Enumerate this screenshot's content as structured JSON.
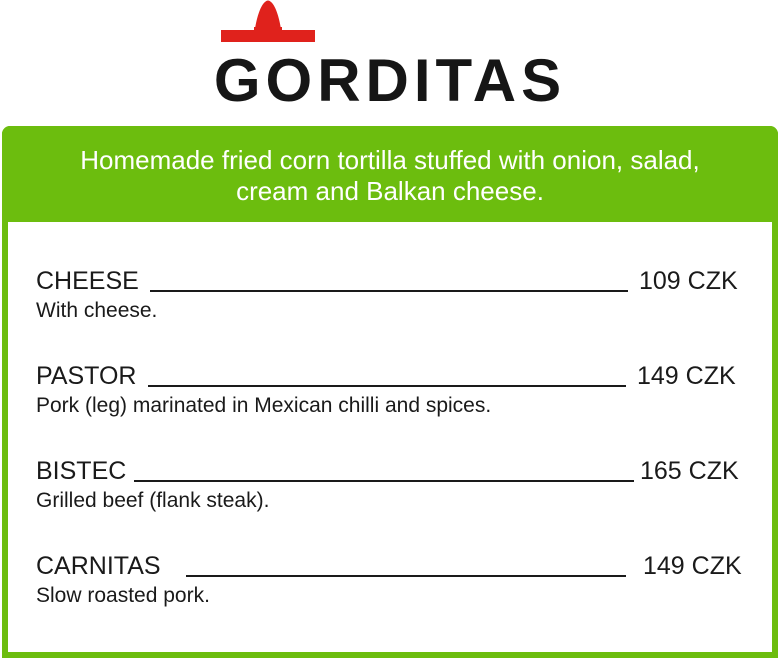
{
  "brand": {
    "title": "GORDITAS",
    "logo_icon": "sombrero-icon",
    "logo_color": "#e0221c"
  },
  "colors": {
    "accent": "#6cbd0e",
    "text": "#1a1a1a"
  },
  "card": {
    "description": "Homemade fried corn tortilla stuffed with onion, salad, cream and Balkan cheese."
  },
  "items": [
    {
      "name": "CHEESE",
      "price": "109 CZK",
      "desc": "With cheese."
    },
    {
      "name": "PASTOR",
      "price": "149 CZK",
      "desc": "Pork (leg) marinated in Mexican chilli and spices."
    },
    {
      "name": "BISTEC",
      "price": "165 CZK",
      "desc": "Grilled beef (flank steak)."
    },
    {
      "name": "CARNITAS",
      "price": "149 CZK",
      "desc": "Slow roasted pork."
    }
  ]
}
